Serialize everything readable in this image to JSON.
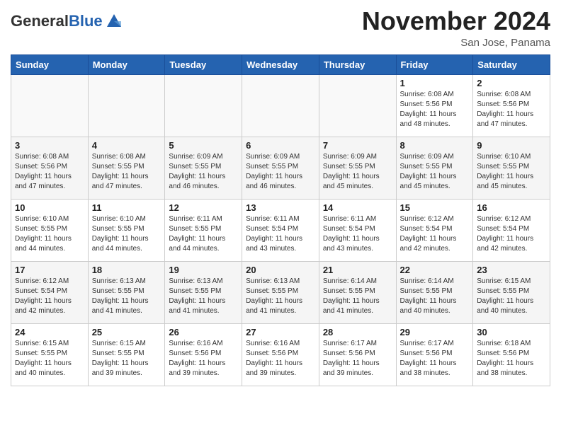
{
  "logo": {
    "general": "General",
    "blue": "Blue"
  },
  "header": {
    "month_title": "November 2024",
    "location": "San Jose, Panama"
  },
  "weekdays": [
    "Sunday",
    "Monday",
    "Tuesday",
    "Wednesday",
    "Thursday",
    "Friday",
    "Saturday"
  ],
  "weeks": [
    [
      {
        "day": "",
        "info": ""
      },
      {
        "day": "",
        "info": ""
      },
      {
        "day": "",
        "info": ""
      },
      {
        "day": "",
        "info": ""
      },
      {
        "day": "",
        "info": ""
      },
      {
        "day": "1",
        "info": "Sunrise: 6:08 AM\nSunset: 5:56 PM\nDaylight: 11 hours\nand 48 minutes."
      },
      {
        "day": "2",
        "info": "Sunrise: 6:08 AM\nSunset: 5:56 PM\nDaylight: 11 hours\nand 47 minutes."
      }
    ],
    [
      {
        "day": "3",
        "info": "Sunrise: 6:08 AM\nSunset: 5:56 PM\nDaylight: 11 hours\nand 47 minutes."
      },
      {
        "day": "4",
        "info": "Sunrise: 6:08 AM\nSunset: 5:55 PM\nDaylight: 11 hours\nand 47 minutes."
      },
      {
        "day": "5",
        "info": "Sunrise: 6:09 AM\nSunset: 5:55 PM\nDaylight: 11 hours\nand 46 minutes."
      },
      {
        "day": "6",
        "info": "Sunrise: 6:09 AM\nSunset: 5:55 PM\nDaylight: 11 hours\nand 46 minutes."
      },
      {
        "day": "7",
        "info": "Sunrise: 6:09 AM\nSunset: 5:55 PM\nDaylight: 11 hours\nand 45 minutes."
      },
      {
        "day": "8",
        "info": "Sunrise: 6:09 AM\nSunset: 5:55 PM\nDaylight: 11 hours\nand 45 minutes."
      },
      {
        "day": "9",
        "info": "Sunrise: 6:10 AM\nSunset: 5:55 PM\nDaylight: 11 hours\nand 45 minutes."
      }
    ],
    [
      {
        "day": "10",
        "info": "Sunrise: 6:10 AM\nSunset: 5:55 PM\nDaylight: 11 hours\nand 44 minutes."
      },
      {
        "day": "11",
        "info": "Sunrise: 6:10 AM\nSunset: 5:55 PM\nDaylight: 11 hours\nand 44 minutes."
      },
      {
        "day": "12",
        "info": "Sunrise: 6:11 AM\nSunset: 5:55 PM\nDaylight: 11 hours\nand 44 minutes."
      },
      {
        "day": "13",
        "info": "Sunrise: 6:11 AM\nSunset: 5:54 PM\nDaylight: 11 hours\nand 43 minutes."
      },
      {
        "day": "14",
        "info": "Sunrise: 6:11 AM\nSunset: 5:54 PM\nDaylight: 11 hours\nand 43 minutes."
      },
      {
        "day": "15",
        "info": "Sunrise: 6:12 AM\nSunset: 5:54 PM\nDaylight: 11 hours\nand 42 minutes."
      },
      {
        "day": "16",
        "info": "Sunrise: 6:12 AM\nSunset: 5:54 PM\nDaylight: 11 hours\nand 42 minutes."
      }
    ],
    [
      {
        "day": "17",
        "info": "Sunrise: 6:12 AM\nSunset: 5:54 PM\nDaylight: 11 hours\nand 42 minutes."
      },
      {
        "day": "18",
        "info": "Sunrise: 6:13 AM\nSunset: 5:55 PM\nDaylight: 11 hours\nand 41 minutes."
      },
      {
        "day": "19",
        "info": "Sunrise: 6:13 AM\nSunset: 5:55 PM\nDaylight: 11 hours\nand 41 minutes."
      },
      {
        "day": "20",
        "info": "Sunrise: 6:13 AM\nSunset: 5:55 PM\nDaylight: 11 hours\nand 41 minutes."
      },
      {
        "day": "21",
        "info": "Sunrise: 6:14 AM\nSunset: 5:55 PM\nDaylight: 11 hours\nand 41 minutes."
      },
      {
        "day": "22",
        "info": "Sunrise: 6:14 AM\nSunset: 5:55 PM\nDaylight: 11 hours\nand 40 minutes."
      },
      {
        "day": "23",
        "info": "Sunrise: 6:15 AM\nSunset: 5:55 PM\nDaylight: 11 hours\nand 40 minutes."
      }
    ],
    [
      {
        "day": "24",
        "info": "Sunrise: 6:15 AM\nSunset: 5:55 PM\nDaylight: 11 hours\nand 40 minutes."
      },
      {
        "day": "25",
        "info": "Sunrise: 6:15 AM\nSunset: 5:55 PM\nDaylight: 11 hours\nand 39 minutes."
      },
      {
        "day": "26",
        "info": "Sunrise: 6:16 AM\nSunset: 5:56 PM\nDaylight: 11 hours\nand 39 minutes."
      },
      {
        "day": "27",
        "info": "Sunrise: 6:16 AM\nSunset: 5:56 PM\nDaylight: 11 hours\nand 39 minutes."
      },
      {
        "day": "28",
        "info": "Sunrise: 6:17 AM\nSunset: 5:56 PM\nDaylight: 11 hours\nand 39 minutes."
      },
      {
        "day": "29",
        "info": "Sunrise: 6:17 AM\nSunset: 5:56 PM\nDaylight: 11 hours\nand 38 minutes."
      },
      {
        "day": "30",
        "info": "Sunrise: 6:18 AM\nSunset: 5:56 PM\nDaylight: 11 hours\nand 38 minutes."
      }
    ]
  ]
}
